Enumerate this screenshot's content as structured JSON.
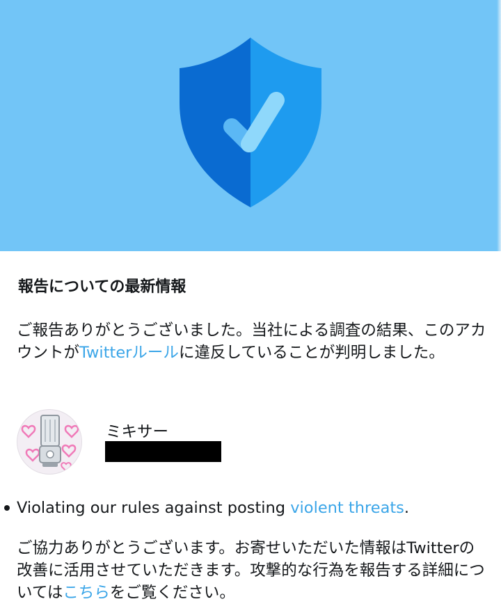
{
  "colors": {
    "hero_bg": "#72c5f7",
    "shield_dark": "#0a6bd1",
    "shield_light": "#1e9bef",
    "check_light": "#8fd8fb",
    "link": "#3aa5e8",
    "text": "#14171a"
  },
  "hero": {
    "icon": "shield-check-icon"
  },
  "report": {
    "heading": "報告についての最新情報",
    "thanks_before": "ご報告ありがとうございました。当社による調査の結果、このアカウントが",
    "rules_link": "Twitterルール",
    "thanks_after": "に違反していることが判明しました。"
  },
  "account": {
    "name": "ミキサー",
    "avatar_icon": "blender-with-hearts-avatar"
  },
  "violation": {
    "text": "Violating our rules against posting ",
    "link": "violent threats",
    "period": "."
  },
  "closing": {
    "before": "ご協力ありがとうございます。お寄せいただいた情報はTwitterの改善に活用させていただきます。攻撃的な行為を報告する詳細については",
    "link": "こちら",
    "after": "をご覧ください。"
  }
}
